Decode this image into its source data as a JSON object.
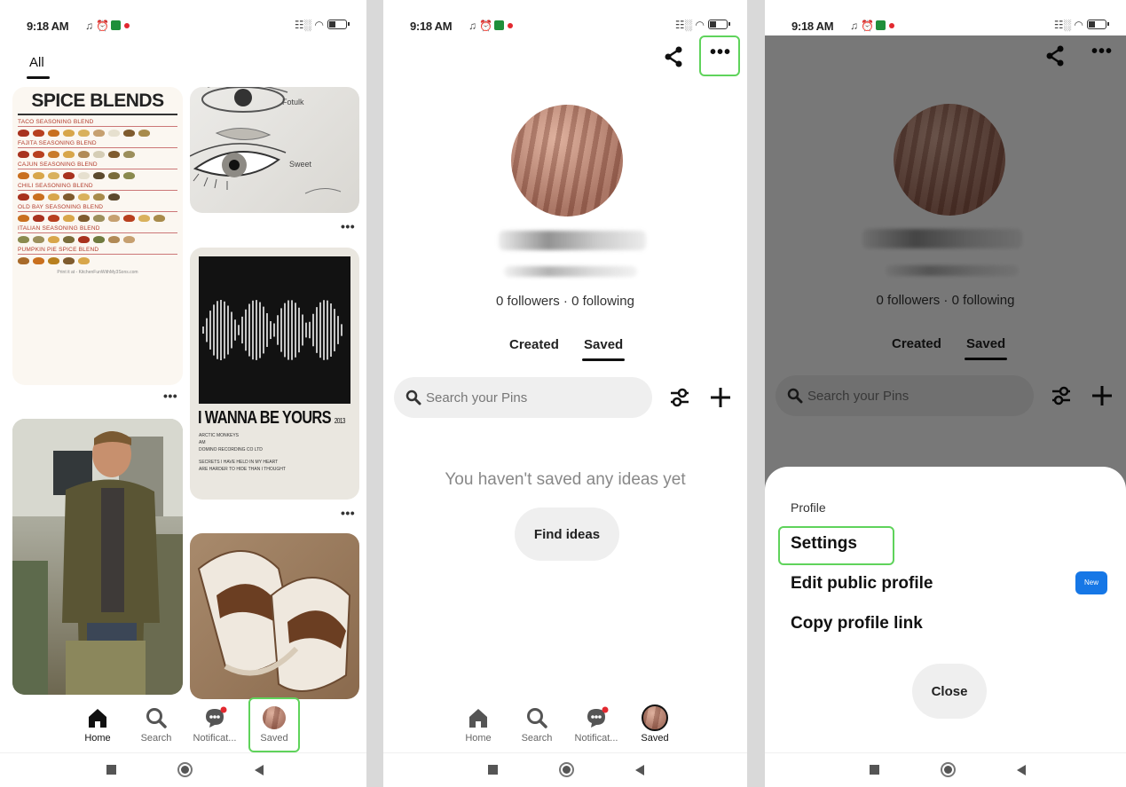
{
  "status": {
    "time": "9:18 AM",
    "icons_left": "♫ ⏰"
  },
  "panel1": {
    "tab_all": "All",
    "spice": {
      "title": "SPICE BLENDS",
      "blends": [
        "TACO SEASONING BLEND",
        "FAJITA SEASONING BLEND",
        "CAJUN SEASONING BLEND",
        "CHILI SEASONING BLEND",
        "OLD BAY SEASONING BLEND",
        "ITALIAN SEASONING BLEND",
        "PUMPKIN PIE SPICE BLEND"
      ],
      "footer": "Print it at - KitchenFunWithMy3Sons.com"
    },
    "eyes_caption": {
      "top": "Fotulk",
      "bottom": "Sweet"
    },
    "poster": {
      "title": "I WANNA BE YOURS",
      "year": "2013",
      "line1": "ARCTIC MONKEYS",
      "line2": "AM",
      "line3": "DOMINO RECORDING CO LTD",
      "line4": "SECRETS I HAVE HELD IN MY HEART",
      "line5": "ARE HARDER TO HIDE THAN I THOUGHT"
    }
  },
  "nav": {
    "home": "Home",
    "search": "Search",
    "notifications": "Notificat...",
    "saved": "Saved"
  },
  "profile": {
    "followers": "0 followers · 0 following",
    "tab_created": "Created",
    "tab_saved": "Saved",
    "search_placeholder": "Search your Pins",
    "empty": "You haven't saved any ideas yet",
    "find_ideas": "Find ideas"
  },
  "sheet": {
    "heading": "Profile",
    "settings": "Settings",
    "edit_profile": "Edit public profile",
    "new_badge": "New",
    "copy_link": "Copy profile link",
    "close": "Close"
  },
  "colors": {
    "highlight": "#5fd35b",
    "badge": "#1677e6",
    "notif_dot": "#e2282f"
  }
}
